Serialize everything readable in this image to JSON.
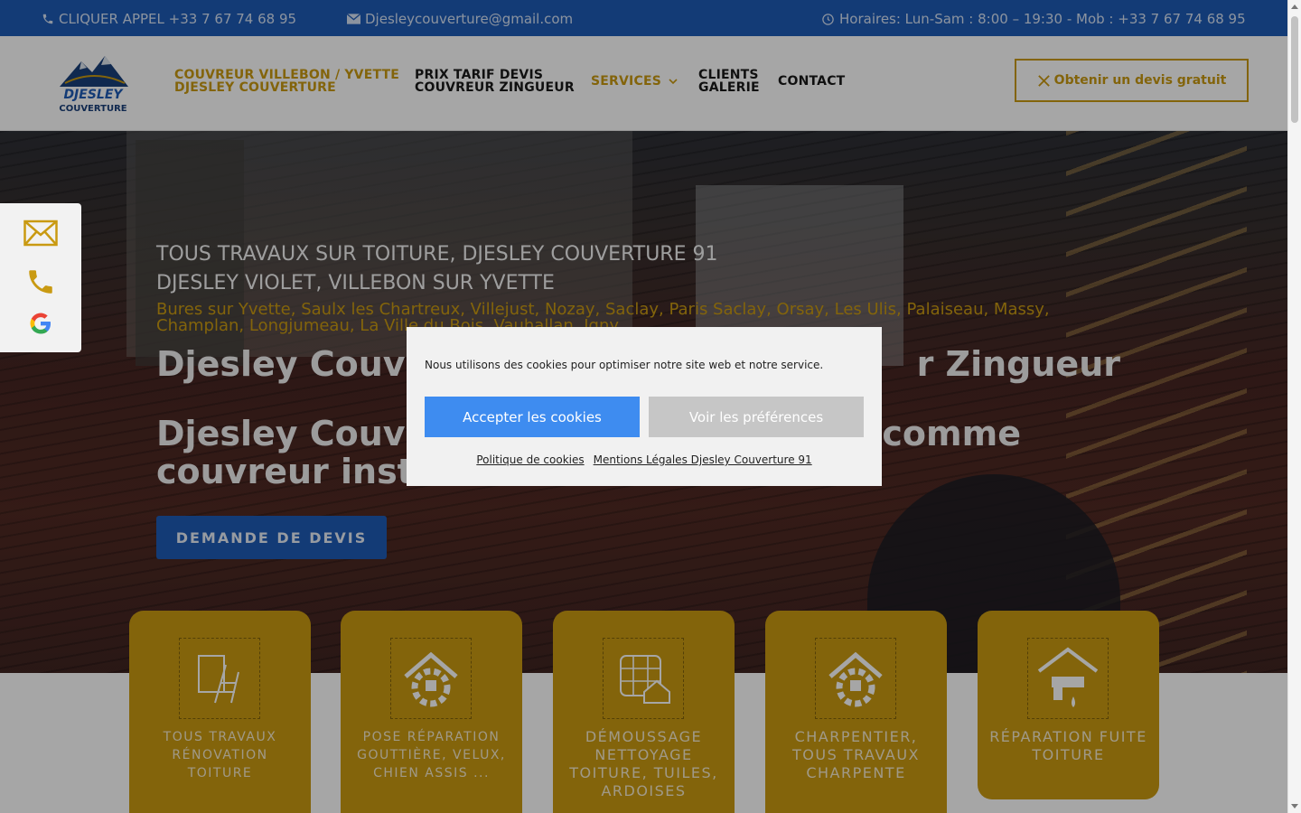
{
  "topbar": {
    "phone": "CLIQUER APPEL +33 7 67 74 68 95",
    "email": "Djesleycouverture@gmail.com",
    "hours": "Horaires: Lun-Sam : 8:00 – 19:30 - Mob : +33 7 67 74 68 95"
  },
  "logo": {
    "line1": "DJESLEY",
    "line2": "COUVERTURE"
  },
  "nav": {
    "item1_line1": "COUVREUR VILLEBON / YVETTE",
    "item1_line2": "DJESLEY COUVERTURE",
    "item2_line1": "PRIX TARIF DEVIS",
    "item2_line2": "COUVREUR ZINGUEUR",
    "item3": "SERVICES",
    "item4_line1": "CLIENTS",
    "item4_line2": "GALERIE",
    "item5": "CONTACT"
  },
  "cta": {
    "label": "Obtenir un devis gratuit"
  },
  "hero": {
    "subtitle1": "TOUS TRAVAUX SUR TOITURE, DJESLEY COUVERTURE 91",
    "subtitle2": "DJESLEY VIOLET, VILLEBON SUR YVETTE",
    "towns": "Bures sur Yvette, Saulx les Chartreux, Villejust, Nozay, Saclay, Paris Saclay, Orsay, Les Ulis, Palaiseau, Massy, Champlan, Longjumeau,   La Ville du Bois, Vauhallan, Igny",
    "title1": "Djesley Couvertu                                    r Zingueur",
    "title2": "Djesley Couve                                   e comme couvreur insta",
    "button": "DEMANDE DE DEVIS"
  },
  "cards": [
    {
      "label": "TOUS TRAVAUX RÉNOVATION TOITURE"
    },
    {
      "label": "POSE RÉPARATION GOUTTIÈRE, VELUX, CHIEN ASSIS ..."
    },
    {
      "label": "DÉMOUSSAGE NETTOYAGE TOITURE, TUILES, ARDOISES"
    },
    {
      "label": "CHARPENTIER, TOUS TRAVAUX CHARPENTE"
    },
    {
      "label": "RÉPARATION FUITE TOITURE"
    }
  ],
  "cookie": {
    "message": "Nous utilisons des cookies pour optimiser notre site web et notre service.",
    "accept": "Accepter les cookies",
    "prefs": "Voir les préférences",
    "link1": "Politique de cookies",
    "link2": "Mentions Légales Djesley Couverture 91"
  },
  "colors": {
    "brand_blue": "#1e5bb5",
    "gold": "#c99a12",
    "cookie_accept": "#3e8cf0"
  }
}
